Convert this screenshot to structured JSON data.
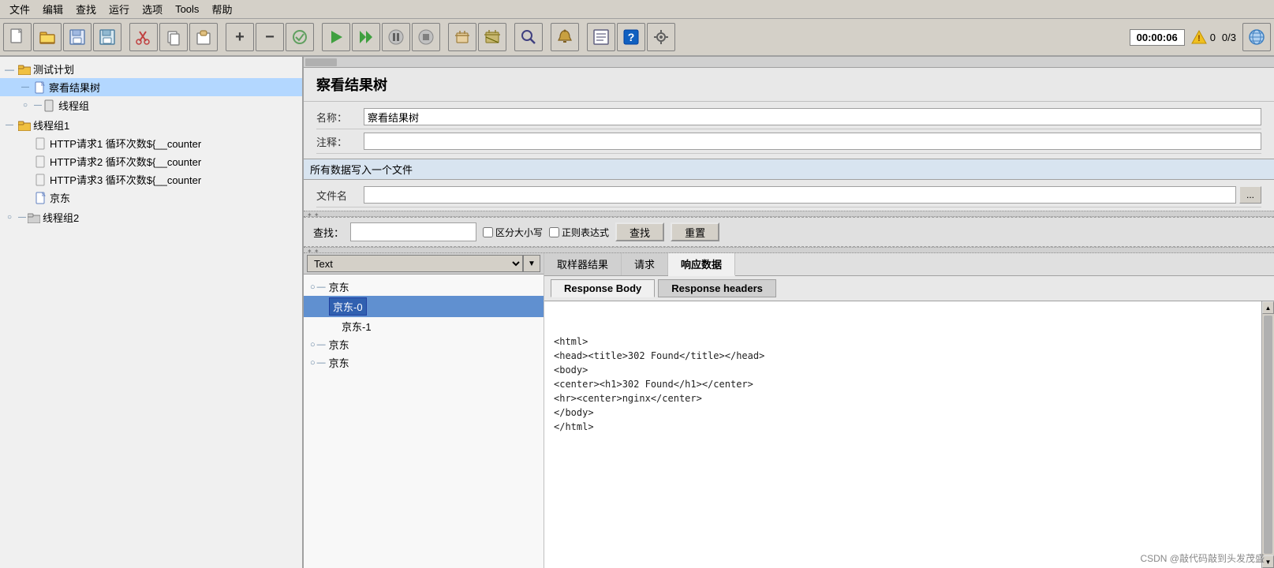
{
  "menubar": {
    "items": [
      "文件",
      "编辑",
      "查找",
      "运行",
      "选项",
      "Tools",
      "帮助"
    ]
  },
  "toolbar": {
    "buttons": [
      {
        "name": "new-btn",
        "icon": "📄"
      },
      {
        "name": "open-btn",
        "icon": "📂"
      },
      {
        "name": "save-as-btn",
        "icon": "🗎"
      },
      {
        "name": "save-btn",
        "icon": "💾"
      },
      {
        "name": "cut-btn",
        "icon": "✂️"
      },
      {
        "name": "copy-btn",
        "icon": "📋"
      },
      {
        "name": "paste-btn",
        "icon": "📌"
      }
    ],
    "toolbar2": [
      {
        "name": "add-btn",
        "icon": "+"
      },
      {
        "name": "remove-btn",
        "icon": "−"
      },
      {
        "name": "clear-btn",
        "icon": "🔄"
      },
      {
        "name": "start-btn",
        "icon": "▶"
      },
      {
        "name": "start2-btn",
        "icon": "▶▶"
      },
      {
        "name": "pause-btn",
        "icon": "⏸"
      },
      {
        "name": "stop-btn",
        "icon": "⏹"
      },
      {
        "name": "broom-btn",
        "icon": "🧹"
      },
      {
        "name": "broom2-btn",
        "icon": "🧺"
      },
      {
        "name": "binoculars-btn",
        "icon": "🔭"
      },
      {
        "name": "bell-btn",
        "icon": "🔔"
      },
      {
        "name": "list-btn",
        "icon": "📋"
      },
      {
        "name": "help-btn",
        "icon": "❓"
      },
      {
        "name": "settings-btn",
        "icon": "⚙"
      }
    ],
    "timer": "00:00:06",
    "warnings": "0",
    "results": "0/3"
  },
  "left_tree": {
    "items": [
      {
        "label": "测试计划",
        "level": 0,
        "type": "folder",
        "connector": ""
      },
      {
        "label": "察看结果树",
        "level": 1,
        "type": "file",
        "connector": "",
        "selected": true
      },
      {
        "label": "线程组",
        "level": 1,
        "type": "file",
        "connector": "○—"
      },
      {
        "label": "线程组1",
        "level": 0,
        "type": "folder",
        "connector": ""
      },
      {
        "label": "HTTP请求1 循环次数${__counter",
        "level": 2,
        "type": "page",
        "connector": ""
      },
      {
        "label": "HTTP请求2 循环次数${__counter",
        "level": 2,
        "type": "page",
        "connector": ""
      },
      {
        "label": "HTTP请求3 循环次数${__counter",
        "level": 2,
        "type": "page",
        "connector": ""
      },
      {
        "label": "京东",
        "level": 2,
        "type": "file",
        "connector": ""
      },
      {
        "label": "线程组2",
        "level": 0,
        "type": "folder",
        "connector": "○—"
      }
    ]
  },
  "right_panel": {
    "title": "察看结果树",
    "name_label": "名称：",
    "name_value": "察看结果树",
    "comment_label": "注释：",
    "comment_value": "",
    "section_header": "所有数据写入一个文件",
    "filename_label": "文件名",
    "filename_value": "",
    "search": {
      "label": "查找：",
      "placeholder": "",
      "case_sensitive": "区分大小写",
      "regex": "正则表达式",
      "find_btn": "查找",
      "reset_btn": "重置"
    },
    "results": {
      "dropdown_value": "Text",
      "tree_items": [
        {
          "label": "京东",
          "level": 0,
          "type": "root",
          "connector": "○"
        },
        {
          "label": "京东-0",
          "level": 1,
          "type": "selected",
          "connector": ""
        },
        {
          "label": "京东-1",
          "level": 1,
          "type": "normal",
          "connector": ""
        },
        {
          "label": "京东",
          "level": 0,
          "type": "root",
          "connector": "○"
        },
        {
          "label": "京东",
          "level": 0,
          "type": "root",
          "connector": "○"
        }
      ],
      "tabs": [
        {
          "label": "取样器结果",
          "active": false
        },
        {
          "label": "请求",
          "active": false
        },
        {
          "label": "响应数据",
          "active": true
        }
      ],
      "sub_tabs": [
        {
          "label": "Response Body",
          "active": true
        },
        {
          "label": "Response headers",
          "active": false
        }
      ],
      "content": "<html>\n<head><title>302 Found</title></head>\n<body>\n<center><h1>302 Found</h1></center>\n<hr><center>nginx</center>\n</body>\n</html>"
    }
  },
  "watermark": "CSDN @敲代码敲到头发茂盛"
}
